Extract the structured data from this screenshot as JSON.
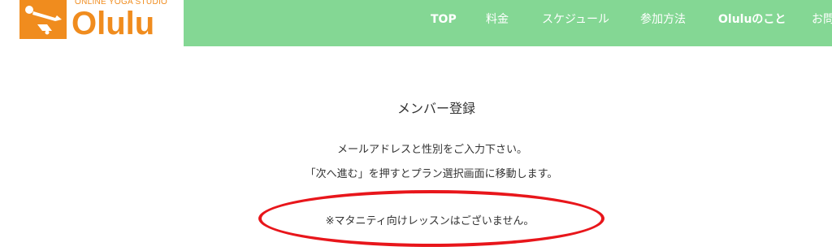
{
  "brand": {
    "subtitle": "ONLINE YOGA STUDIO",
    "name": "Olulu",
    "color": "#f08c1e"
  },
  "header": {
    "background": "#84d794"
  },
  "breadcrumb_fragment": "",
  "nav": {
    "items": [
      {
        "label": "TOP"
      },
      {
        "label": "料金"
      },
      {
        "label": "スケジュール"
      },
      {
        "label": "参加方法"
      },
      {
        "label": "Oluluのこと"
      },
      {
        "label": "お問"
      }
    ]
  },
  "main": {
    "title": "メンバー登録",
    "instruction_1": "メールアドレスと性別をご入力下さい。",
    "instruction_2": "「次へ進む」を押すとプラン選択画面に移動します。",
    "notice": "※マタニティ向けレッスンはございません。"
  },
  "annotation": {
    "circle_color": "#e8161b"
  }
}
